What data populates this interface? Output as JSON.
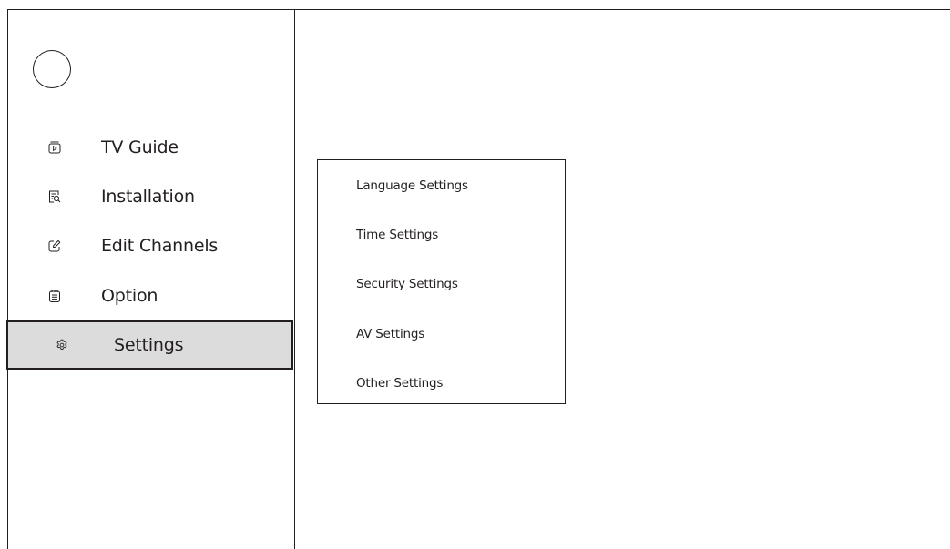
{
  "sidebar": {
    "items": [
      {
        "label": "TV Guide",
        "icon": "play-screen-icon"
      },
      {
        "label": "Installation",
        "icon": "search-list-icon"
      },
      {
        "label": "Edit Channels",
        "icon": "edit-icon"
      },
      {
        "label": "Option",
        "icon": "notepad-icon"
      },
      {
        "label": "Settings",
        "icon": "gear-icon",
        "active": true
      }
    ]
  },
  "submenu": {
    "items": [
      {
        "label": "Language Settings"
      },
      {
        "label": "Time Settings"
      },
      {
        "label": "Security Settings"
      },
      {
        "label": "AV Settings"
      },
      {
        "label": "Other Settings"
      }
    ]
  },
  "colors": {
    "stroke": "#231f20",
    "active_background": "#dcdcdc",
    "background": "#ffffff"
  }
}
